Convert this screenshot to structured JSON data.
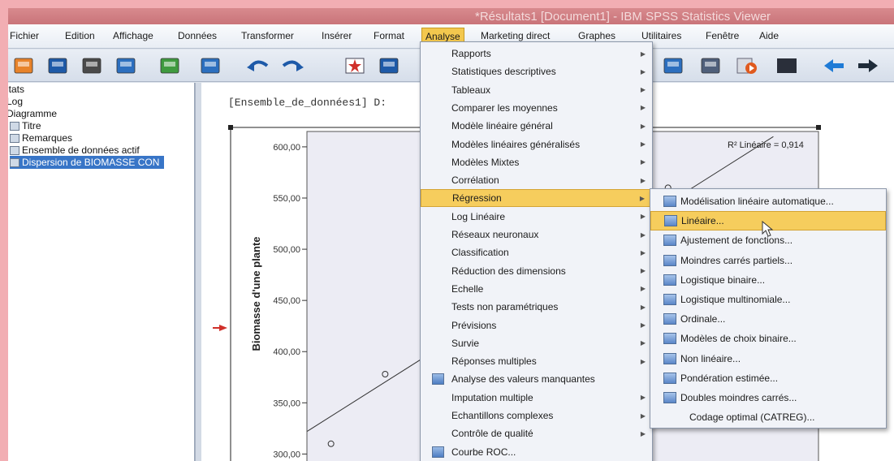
{
  "window": {
    "title": "*Résultats1 [Document1] - IBM SPSS Statistics Viewer"
  },
  "menubar": {
    "items": [
      "Fichier",
      "Edition",
      "Affichage",
      "Données",
      "Transformer",
      "Insérer",
      "Format",
      "Analyse",
      "Marketing direct",
      "Graphes",
      "Utilitaires",
      "Fenêtre",
      "Aide"
    ],
    "active": "Analyse"
  },
  "toolbar": {
    "icons": [
      "open-folder-icon",
      "save-icon",
      "print-icon",
      "print-preview-icon",
      "export-icon",
      "dialog-recall-icon",
      "undo-icon",
      "redo-icon",
      "goto-data-icon",
      "variables-icon",
      "chart-builder-icon",
      "edit-icon",
      "play-icon",
      "designate-window-icon",
      "back-arrow-icon",
      "forward-arrow-icon"
    ]
  },
  "outline": {
    "items": [
      {
        "label": "ltats",
        "indent": 0
      },
      {
        "label": "Log",
        "indent": 0
      },
      {
        "label": "Diagramme",
        "indent": 0
      },
      {
        "label": "Titre",
        "indent": 1
      },
      {
        "label": "Remarques",
        "indent": 1
      },
      {
        "label": "Ensemble de données actif",
        "indent": 1
      },
      {
        "label": "Dispersion de BIOMASSE CON",
        "indent": 1,
        "selected": true
      }
    ]
  },
  "content": {
    "dataset_line": "[Ensemble_de_données1] D:"
  },
  "chart_data": {
    "type": "scatter",
    "ylabel": "Biomasse d'une plante",
    "yticks": [
      "300,00",
      "350,00",
      "400,00",
      "450,00",
      "500,00",
      "550,00",
      "600,00"
    ],
    "ylim": [
      290,
      615
    ],
    "r2_label": "R² Linéaire = 0,914",
    "points": [
      {
        "x": 0.08,
        "y": 310
      },
      {
        "x": 0.26,
        "y": 378
      },
      {
        "x": 1.2,
        "y": 560
      }
    ],
    "fit_line": [
      {
        "x": 0.0,
        "y": 322
      },
      {
        "x": 1.55,
        "y": 610
      }
    ],
    "xlim": [
      0,
      1.7
    ]
  },
  "analyse_menu": {
    "items": [
      {
        "label": "Rapports",
        "submenu": true
      },
      {
        "label": "Statistiques descriptives",
        "submenu": true
      },
      {
        "label": "Tableaux",
        "submenu": true
      },
      {
        "label": "Comparer les moyennes",
        "submenu": true
      },
      {
        "label": "Modèle linéaire général",
        "submenu": true
      },
      {
        "label": "Modèles linéaires généralisés",
        "submenu": true
      },
      {
        "label": "Modèles Mixtes",
        "submenu": true
      },
      {
        "label": "Corrélation",
        "submenu": true
      },
      {
        "label": "Régression",
        "submenu": true,
        "highlighted": true
      },
      {
        "label": "Log Linéaire",
        "submenu": true
      },
      {
        "label": "Réseaux neuronaux",
        "submenu": true
      },
      {
        "label": "Classification",
        "submenu": true
      },
      {
        "label": "Réduction des dimensions",
        "submenu": true
      },
      {
        "label": "Echelle",
        "submenu": true
      },
      {
        "label": "Tests non paramétriques",
        "submenu": true
      },
      {
        "label": "Prévisions",
        "submenu": true
      },
      {
        "label": "Survie",
        "submenu": true
      },
      {
        "label": "Réponses multiples",
        "submenu": true
      },
      {
        "label": "Analyse des valeurs manquantes",
        "submenu": false,
        "icon": true
      },
      {
        "label": "Imputation multiple",
        "submenu": true
      },
      {
        "label": "Echantillons complexes",
        "submenu": true
      },
      {
        "label": "Contrôle de qualité",
        "submenu": true
      },
      {
        "label": "Courbe ROC...",
        "submenu": false,
        "icon": true
      }
    ]
  },
  "regression_submenu": {
    "items": [
      {
        "label": "Modélisation linéaire automatique...",
        "icon": true
      },
      {
        "label": "Linéaire...",
        "icon": true,
        "highlighted": true
      },
      {
        "label": "Ajustement de fonctions...",
        "icon": true
      },
      {
        "label": "Moindres carrés partiels...",
        "icon": true
      },
      {
        "label": "Logistique binaire...",
        "icon": true
      },
      {
        "label": "Logistique multinomiale...",
        "icon": true
      },
      {
        "label": "Ordinale...",
        "icon": true
      },
      {
        "label": "Modèles de choix binaire...",
        "icon": true
      },
      {
        "label": "Non linéaire...",
        "icon": true
      },
      {
        "label": "Pondération estimée...",
        "icon": true
      },
      {
        "label": "Doubles moindres carrés...",
        "icon": true
      },
      {
        "label": "Codage optimal (CATREG)...",
        "icon": false
      }
    ]
  }
}
